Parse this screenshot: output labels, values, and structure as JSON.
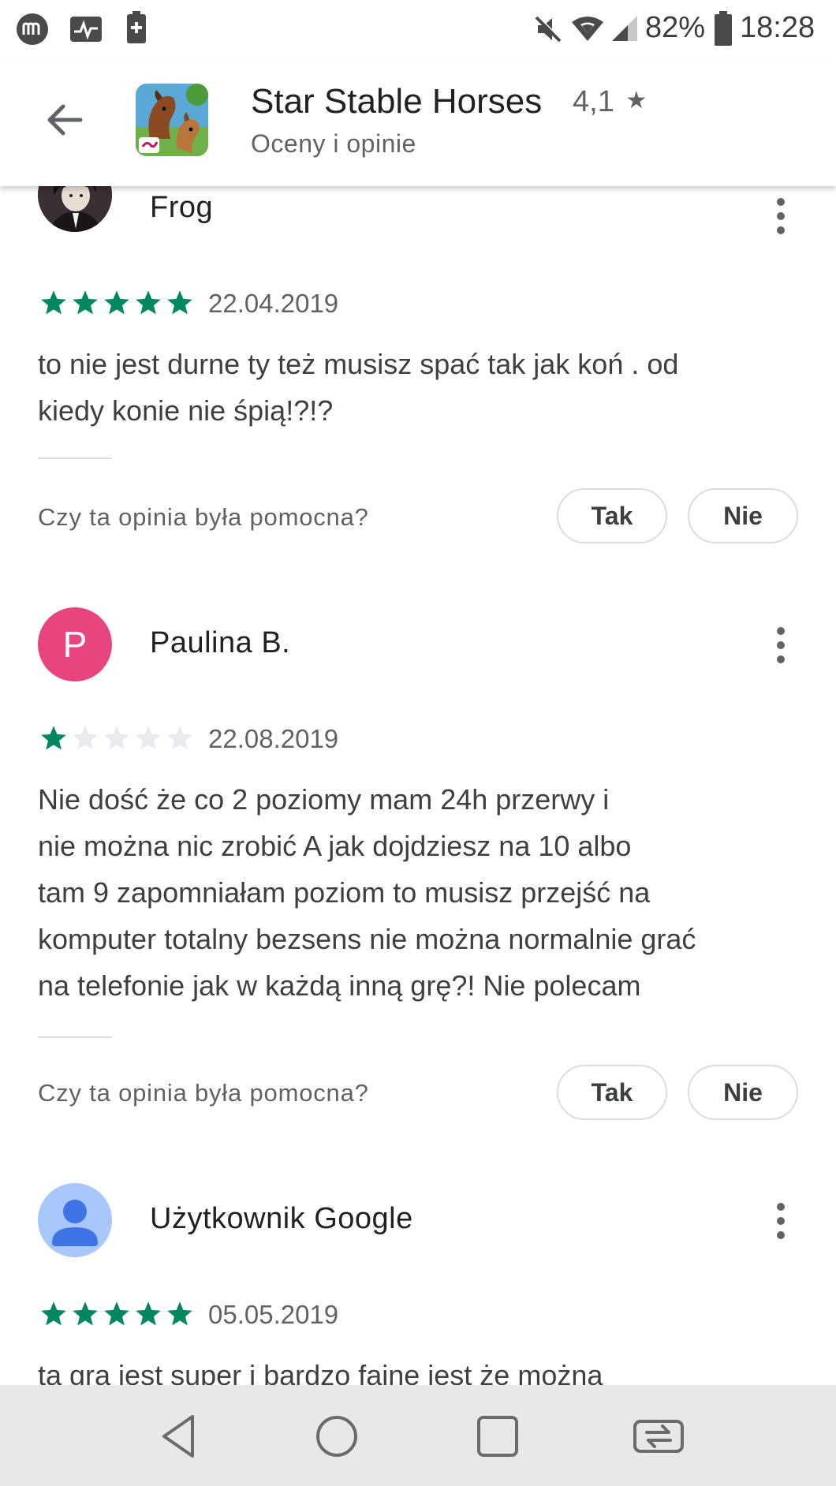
{
  "status_bar": {
    "battery": "82%",
    "time": "18:28"
  },
  "header": {
    "app_name": "Star Stable Horses",
    "rating": "4,1",
    "subtitle": "Oceny i opinie"
  },
  "reviews": [
    {
      "name": "Frog",
      "stars": 5,
      "date": "22.04.2019",
      "text_lines": [
        "to nie jest durne ty też musisz spać tak jak koń . od",
        "kiedy konie nie śpią!?!?"
      ],
      "helpful_question": "Czy ta opinia była pomocna?",
      "yes_label": "Tak",
      "no_label": "Nie"
    },
    {
      "name": "Paulina B.",
      "avatar_letter": "P",
      "avatar_color": "#e8457f",
      "stars": 1,
      "date": "22.08.2019",
      "text_lines": [
        "Nie dość że co 2 poziomy mam 24h przerwy i",
        "nie można nic zrobić A jak dojdziesz na 10 albo",
        "tam 9 zapomniałam poziom to musisz przejść na",
        "komputer totalny bezsens nie można normalnie grać",
        "na telefonie jak w każdą inną grę?! Nie polecam"
      ],
      "helpful_question": "Czy ta opinia była pomocna?",
      "yes_label": "Tak",
      "no_label": "Nie"
    },
    {
      "name": "Użytkownik Google",
      "avatar_color": "#a8c7fa",
      "stars": 5,
      "date": "05.05.2019",
      "text_lines": [
        "ta gra jest super i bardzo faine jest że można"
      ]
    }
  ],
  "colors": {
    "star_filled": "#01875f",
    "star_empty": "#e8eaed"
  },
  "icons": {
    "back": "arrow-back-icon",
    "more": "more-vert-icon",
    "nav_back": "triangle-back-icon",
    "nav_home": "circle-home-icon",
    "nav_recents": "square-recents-icon",
    "nav_switch": "app-switch-icon"
  }
}
